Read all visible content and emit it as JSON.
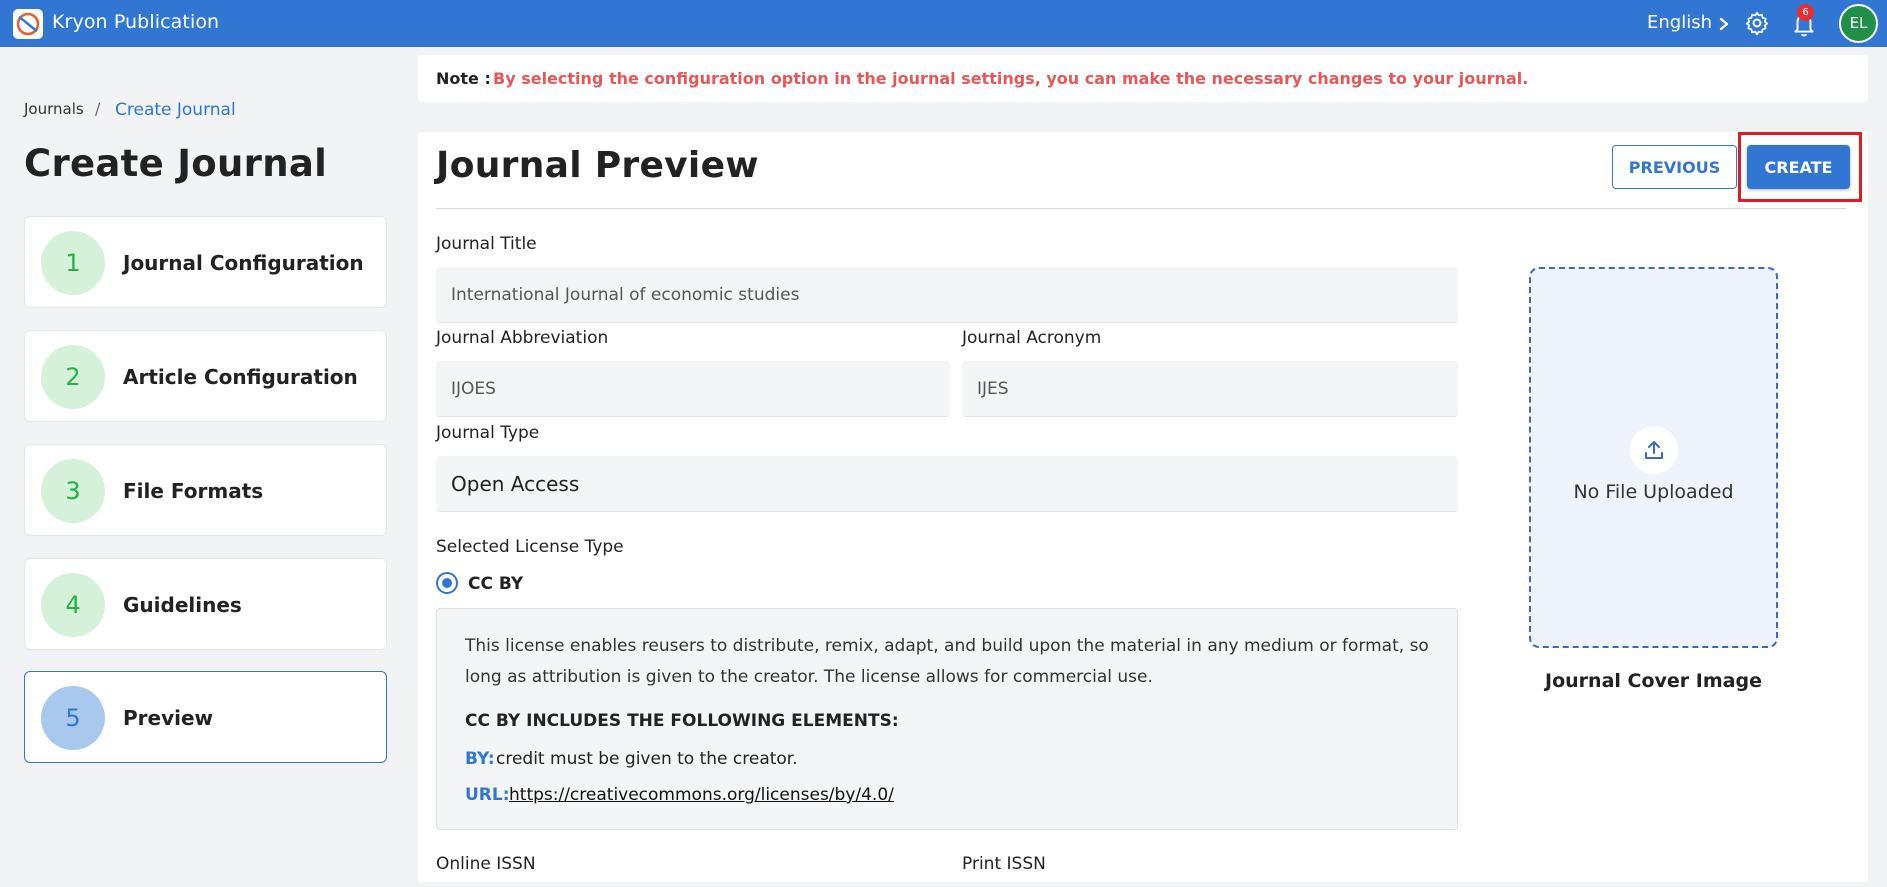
{
  "app": {
    "title": "Kryon Publication"
  },
  "header": {
    "language": "English",
    "notification_count": "6",
    "avatar_initials": "EL"
  },
  "breadcrumb": {
    "root": "Journals",
    "separator": "/",
    "current": "Create Journal"
  },
  "page_title": "Create Journal",
  "steps": [
    {
      "number": "1",
      "label": "Journal Configuration"
    },
    {
      "number": "2",
      "label": "Article Configuration"
    },
    {
      "number": "3",
      "label": "File Formats"
    },
    {
      "number": "4",
      "label": "Guidelines"
    },
    {
      "number": "5",
      "label": "Preview"
    }
  ],
  "note": {
    "label": "Note :",
    "text": "By selecting the configuration option in the journal settings, you can make the necessary changes to your journal."
  },
  "preview": {
    "title": "Journal Preview",
    "previous_label": "PREVIOUS",
    "create_label": "CREATE",
    "journal_title_label": "Journal Title",
    "journal_title_value": "International Journal of economic studies",
    "abbreviation_label": "Journal Abbreviation",
    "abbreviation_value": "IJOES",
    "acronym_label": "Journal Acronym",
    "acronym_value": "IJES",
    "type_label": "Journal Type",
    "type_value": "Open Access",
    "license_label": "Selected License Type",
    "license_option": "CC BY",
    "license_description": "This license enables reusers to distribute, remix, adapt, and build upon the material in any medium or format, so long as attribution is given to the creator. The license allows for commercial use.",
    "license_heading": "CC BY INCLUDES THE FOLLOWING ELEMENTS:",
    "by_key": "BY:",
    "by_value": "credit must be given to the creator.",
    "url_key": "URL:",
    "url_value": "https://creativecommons.org/licenses/by/4.0/",
    "online_issn_label": "Online ISSN",
    "print_issn_label": "Print ISSN",
    "cover_status": "No File Uploaded",
    "cover_caption": "Journal Cover Image"
  },
  "colors": {
    "primary": "#3176d3",
    "note_text": "#e65858",
    "highlight": "#e01b24",
    "step_done_bg": "#d6f1d9",
    "step_done_fg": "#22b43f"
  }
}
